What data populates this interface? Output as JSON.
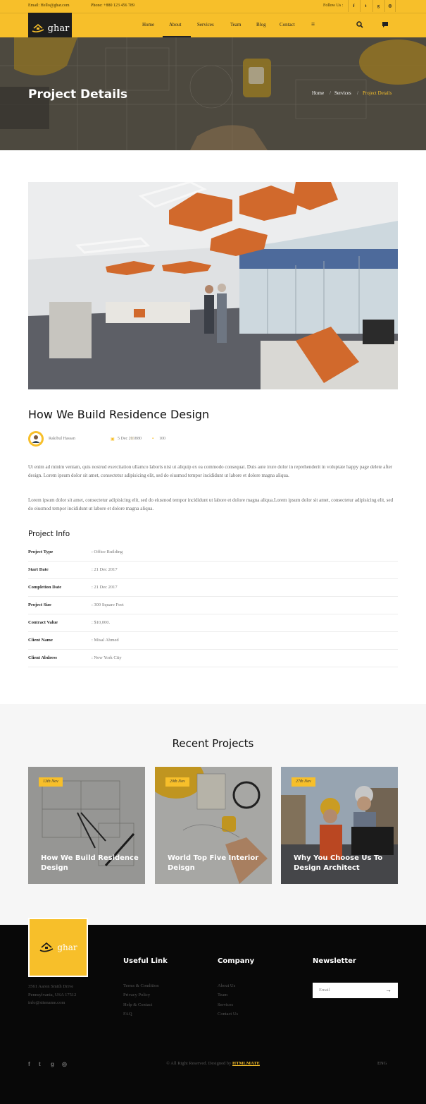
{
  "topbar": {
    "email": "Email: Hello@ghar.com",
    "phone": "Phone: +880 123 456 789",
    "follow": "Follow Us :",
    "social": [
      {
        "icon": "facebook-icon",
        "glyph": "f"
      },
      {
        "icon": "twitter-icon",
        "glyph": "t"
      },
      {
        "icon": "google-plus-icon",
        "glyph": "g"
      },
      {
        "icon": "instagram-icon",
        "glyph": "◎"
      }
    ]
  },
  "brand": {
    "name": "ghar"
  },
  "nav": {
    "items": [
      "Home",
      "About",
      "Services",
      "Team",
      "Blog",
      "Contact"
    ],
    "active": "About",
    "menu_glyph": "≡",
    "search_glyph": "⌕",
    "chat_glyph": "▪"
  },
  "banner": {
    "title": "Project Details",
    "crumbs": [
      "Home",
      "Services",
      "Project Details"
    ],
    "separator": "/"
  },
  "post": {
    "title": "How We Build Residence Design",
    "author": "Rakibul Hassan",
    "date": "5 Dec 2018",
    "likes": "80",
    "comments": "100",
    "paragraphs": [
      "Ut enim ad minim veniam, quis nostrud exercitation ullamco laboris nisi ut aliquip ex ea commodo consequat. Duis aute irure dolor in reprehenderit in voluptate happy page delete after design. Lorem ipsum dolor sit amet, consectetur adipisicing elit, sed do eiusmod tempor incididunt ut labore et dolore magna aliqua.",
      "Lorem ipsum dolor sit amet, consectetur adipisicing elit, sed do eiusmod tempor incididunt ut labore et dolore magna aliqua.Lorem ipsum dolor sit amet, consectetur adipisicing elit, sed do eiusmod tempor incididunt ut labore et dolore magna aliqua."
    ]
  },
  "project_info": {
    "title": "Project Info",
    "rows": [
      {
        "label": "Project Type",
        "value": ": Office Building"
      },
      {
        "label": "Start Date",
        "value": ": 21 Dec 2017"
      },
      {
        "label": "Completion Date",
        "value": ": 21 Dec 2017"
      },
      {
        "label": "Project Size",
        "value": ": 300 Square Feet"
      },
      {
        "label": "Contract Value",
        "value": ": $10,000."
      },
      {
        "label": "Client Name",
        "value": ": Misal Ahmed"
      },
      {
        "label": "Client Abdress",
        "value": ": New York City"
      }
    ]
  },
  "recent": {
    "title": "Recent Projects",
    "cards": [
      {
        "date": "13th Nov",
        "title": "How We Build Residence Design"
      },
      {
        "date": "20th Nov",
        "title": "World Top Five Interior Deisgn"
      },
      {
        "date": "27th Nov",
        "title": "Why You Choose Us To Design Architect"
      }
    ]
  },
  "footer": {
    "address": [
      "3561 Aaron Smith Drive",
      "Pennsylvania, USA 17512",
      "info@sitename.com"
    ],
    "useful_title": "Useful Link",
    "useful_links": [
      "Terms & Condition",
      "Privacy Policy",
      "Help & Contact",
      "FAQ"
    ],
    "company_title": "Company",
    "company_links": [
      "About Us",
      "Team",
      "Services",
      "Contact Us"
    ],
    "newsletter_title": "Newsletter",
    "email_placeholder": "Email",
    "submit_glyph": "→",
    "copyright_prefix": "© All Right Reserved. Designed by",
    "copyright_brand": "HTMLMATE",
    "lang": "ENG",
    "social": [
      "f",
      "t",
      "g",
      "◎"
    ]
  },
  "colors": {
    "accent": "#f7bf2a",
    "dark": "#080808"
  }
}
